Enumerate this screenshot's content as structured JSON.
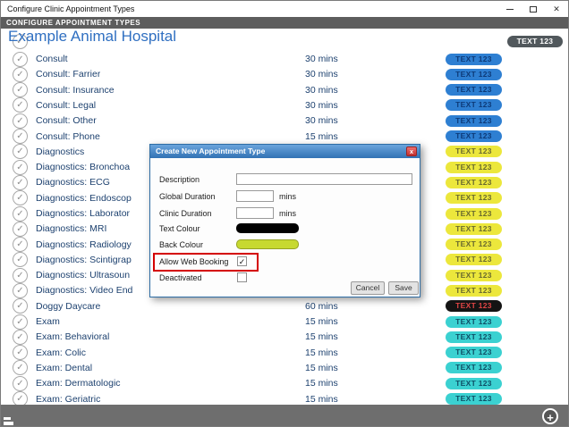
{
  "window": {
    "title": "Configure Clinic Appointment Types"
  },
  "icons": {
    "check": "✓",
    "close": "✕",
    "dialog_close": "x",
    "add": "+"
  },
  "header": {
    "banner": "CONFIGURE APPOINTMENT TYPES",
    "clinic_name": "Example Animal Hospital"
  },
  "list": {
    "badge_label": "TEXT 123",
    "partial_row": {
      "badge_bg": "#51585c",
      "badge_fg": "#ffffff"
    },
    "rows": [
      {
        "name": "Consult",
        "duration": "30 mins",
        "badge_bg": "#2e7fd2",
        "badge_fg": "#0d3a78"
      },
      {
        "name": "Consult: Farrier",
        "duration": "30 mins",
        "badge_bg": "#2e7fd2",
        "badge_fg": "#0d3a78"
      },
      {
        "name": "Consult: Insurance",
        "duration": "30 mins",
        "badge_bg": "#2e7fd2",
        "badge_fg": "#0d3a78"
      },
      {
        "name": "Consult: Legal",
        "duration": "30 mins",
        "badge_bg": "#2e7fd2",
        "badge_fg": "#0d3a78"
      },
      {
        "name": "Consult: Other",
        "duration": "30 mins",
        "badge_bg": "#2e7fd2",
        "badge_fg": "#0d3a78"
      },
      {
        "name": "Consult: Phone",
        "duration": "15 mins",
        "badge_bg": "#2e7fd2",
        "badge_fg": "#0d3a78"
      },
      {
        "name": "Diagnostics",
        "duration": "",
        "badge_bg": "#ece73c",
        "badge_fg": "#6a6a2d"
      },
      {
        "name": "Diagnostics: Bronchoa",
        "duration": "",
        "badge_bg": "#ece73c",
        "badge_fg": "#6a6a2d"
      },
      {
        "name": "Diagnostics: ECG",
        "duration": "",
        "badge_bg": "#ece73c",
        "badge_fg": "#6a6a2d"
      },
      {
        "name": "Diagnostics: Endoscop",
        "duration": "",
        "badge_bg": "#ece73c",
        "badge_fg": "#6a6a2d"
      },
      {
        "name": "Diagnostics: Laborator",
        "duration": "",
        "badge_bg": "#ece73c",
        "badge_fg": "#6a6a2d"
      },
      {
        "name": "Diagnostics: MRI",
        "duration": "",
        "badge_bg": "#ece73c",
        "badge_fg": "#6a6a2d"
      },
      {
        "name": "Diagnostics: Radiology",
        "duration": "",
        "badge_bg": "#ece73c",
        "badge_fg": "#6a6a2d"
      },
      {
        "name": "Diagnostics: Scintigrap",
        "duration": "",
        "badge_bg": "#ece73c",
        "badge_fg": "#6a6a2d"
      },
      {
        "name": "Diagnostics: Ultrasoun",
        "duration": "",
        "badge_bg": "#ece73c",
        "badge_fg": "#6a6a2d"
      },
      {
        "name": "Diagnostics: Video End",
        "duration": "",
        "badge_bg": "#ece73c",
        "badge_fg": "#6a6a2d"
      },
      {
        "name": "Doggy Daycare",
        "duration": "60 mins",
        "badge_bg": "#141414",
        "badge_fg": "#e04545"
      },
      {
        "name": "Exam",
        "duration": "15 mins",
        "badge_bg": "#3bd1d1",
        "badge_fg": "#0e4f66"
      },
      {
        "name": "Exam: Behavioral",
        "duration": "15 mins",
        "badge_bg": "#3bd1d1",
        "badge_fg": "#0e4f66"
      },
      {
        "name": "Exam: Colic",
        "duration": "15 mins",
        "badge_bg": "#3bd1d1",
        "badge_fg": "#0e4f66"
      },
      {
        "name": "Exam: Dental",
        "duration": "15 mins",
        "badge_bg": "#3bd1d1",
        "badge_fg": "#0e4f66"
      },
      {
        "name": "Exam: Dermatologic",
        "duration": "15 mins",
        "badge_bg": "#3bd1d1",
        "badge_fg": "#0e4f66"
      },
      {
        "name": "Exam: Geriatric",
        "duration": "15 mins",
        "badge_bg": "#3bd1d1",
        "badge_fg": "#0e4f66"
      }
    ]
  },
  "dialog": {
    "title": "Create New Appointment Type",
    "annotation_color": "#d40000",
    "fields": {
      "description_label": "Description",
      "global_duration_label": "Global Duration",
      "clinic_duration_label": "Clinic Duration",
      "mins_label": "mins",
      "text_colour_label": "Text Colour",
      "back_colour_label": "Back Colour",
      "allow_web_booking_label": "Allow Web Booking",
      "deactivated_label": "Deactivated",
      "description_value": "",
      "global_duration_value": "",
      "clinic_duration_value": "",
      "text_colour_value": "#000000",
      "back_colour_value": "#c7d930",
      "allow_web_booking_checked": true,
      "deactivated_checked": false
    },
    "buttons": {
      "cancel": "Cancel",
      "save": "Save"
    }
  }
}
